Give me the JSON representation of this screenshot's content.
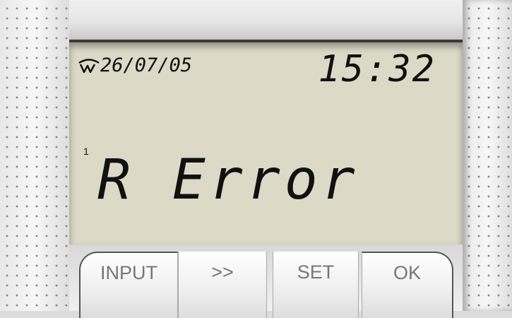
{
  "display": {
    "date": "26/07/05",
    "time": "15:32",
    "channel": "1",
    "message": "R Error",
    "logo_icon": "w-logo-icon",
    "background_color": "#dcdac7"
  },
  "buttons": {
    "input_label": "INPUT",
    "next_label": ">>",
    "set_label": "SET",
    "ok_label": "OK"
  }
}
